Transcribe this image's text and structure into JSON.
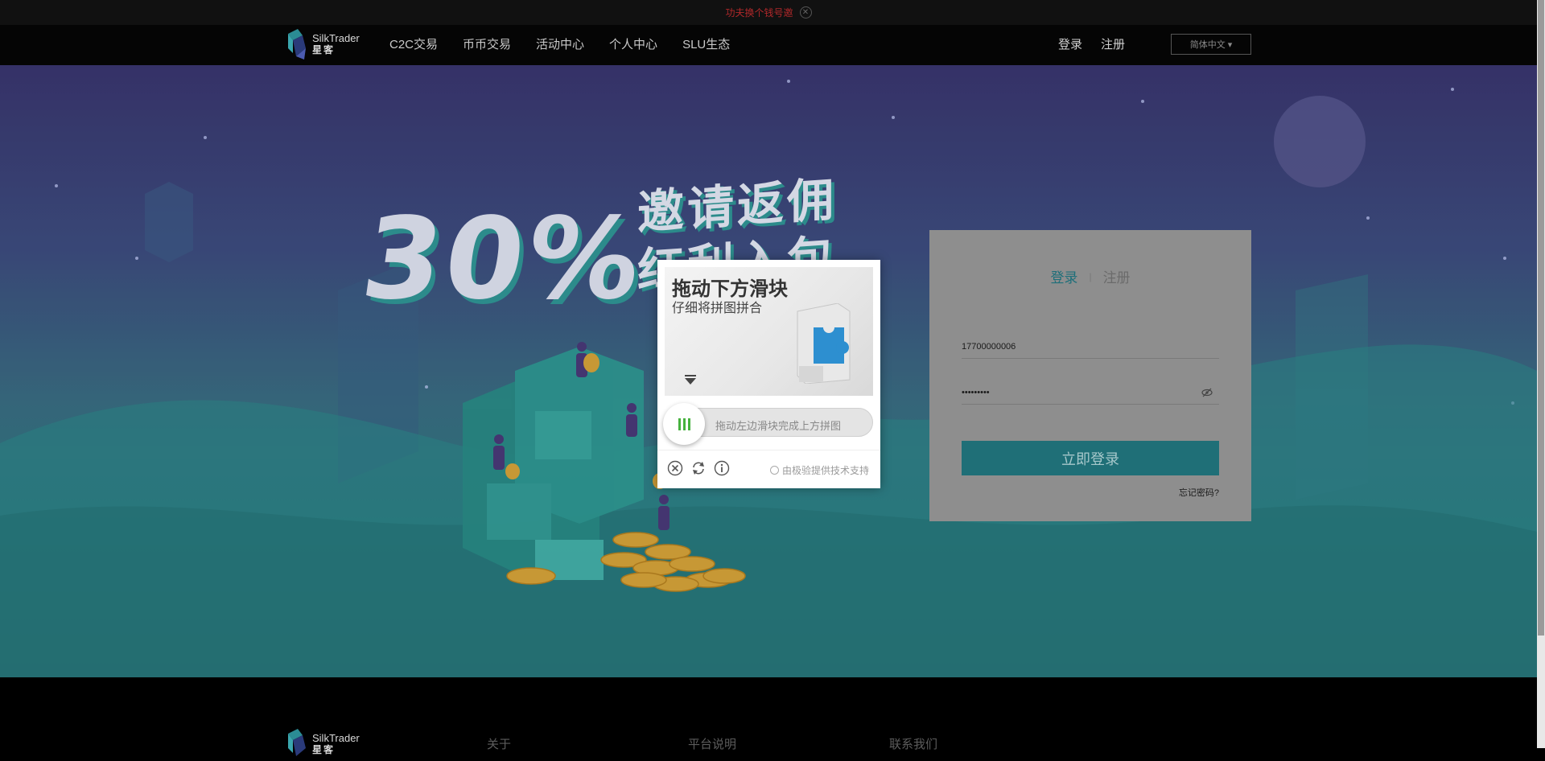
{
  "notice_bar": {
    "text": "功夫换个钱号邀"
  },
  "header": {
    "logo": {
      "en": "SilkTrader",
      "cn": "星客"
    },
    "nav": [
      "C2C交易",
      "币币交易",
      "活动中心",
      "个人中心",
      "SLU生态"
    ],
    "login_link": "登录",
    "register_link": "注册",
    "language": "简体中文 ▾"
  },
  "promo": {
    "percent": "30%",
    "line1": "邀请返佣",
    "line2": "红利入包"
  },
  "login_form": {
    "tab_login": "登录",
    "tab_separator": "|",
    "tab_register": "注册",
    "phone_value": "17700000006",
    "password_value": "•••••••••",
    "submit_label": "立即登录",
    "forgot_label": "忘记密码?"
  },
  "captcha": {
    "title": "拖动下方滑块",
    "subtitle": "仔细将拼图拼合",
    "slider_hint": "拖动左边滑块完成上方拼图",
    "powered_by": "由极验提供技术支持"
  },
  "footer": {
    "logo": {
      "en": "SilkTrader",
      "cn": "星客"
    },
    "columns": [
      "关于",
      "平台说明",
      "联系我们"
    ]
  },
  "colors": {
    "accent": "#1f6f77",
    "slider_grip": "#46b23e",
    "notice": "#b0282a"
  }
}
